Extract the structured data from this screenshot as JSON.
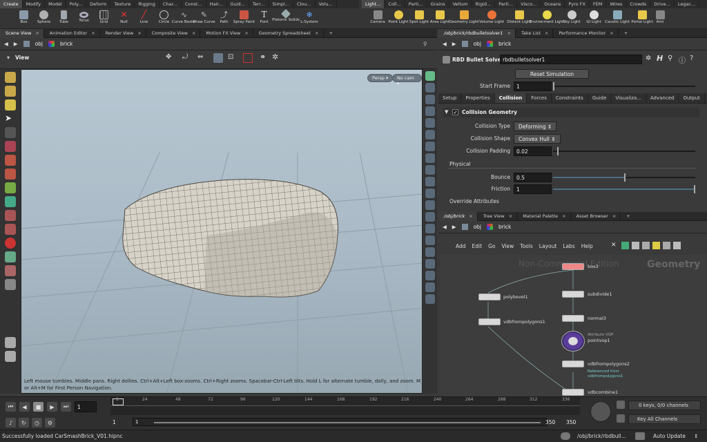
{
  "shelf": {
    "left_tabs": [
      "Create",
      "Modify",
      "Model",
      "Poly...",
      "Deform",
      "Texture",
      "Rigging",
      "Char...",
      "Const...",
      "Hair...",
      "Guid...",
      "Terr...",
      "Simpl...",
      "Clou...",
      "Volu..."
    ],
    "right_tabs": [
      "Light...",
      "Coll...",
      "Parti...",
      "Grains",
      "Vellum",
      "Rigid...",
      "Parti...",
      "Visco...",
      "Oceans",
      "Pyro FX",
      "FEM",
      "Wires",
      "Crowds",
      "Drive...",
      "Legac..."
    ],
    "left_tools": [
      "Box",
      "Sphere",
      "Tube",
      "Torus",
      "Grid",
      "Null",
      "Line",
      "Circle",
      "Curve Bezier",
      "Draw Curve",
      "Path",
      "Spray Paint",
      "Font",
      "Platonic Solids",
      "L-System"
    ],
    "right_tools": [
      "Camera",
      "Point Light",
      "Spot Light",
      "Area Light",
      "Geometry Light",
      "Volume Light",
      "Distant Light",
      "Environment Light",
      "Sky Light",
      "GI Light",
      "Caustic Light",
      "Portal Light",
      "Ami"
    ]
  },
  "left_pane": {
    "tabs": [
      "Scene View",
      "Animation Editor",
      "Render View",
      "Composite View",
      "Motion FX View",
      "Geometry Spreadsheet"
    ],
    "path": [
      "obj",
      "brick"
    ],
    "view_title": "View",
    "persp_label": "Persp ▾",
    "cam_label": "No cam ▾",
    "help_text": "Left mouse tumbles. Middle pans. Right dollies. Ctrl+Alt+Left box-zooms. Ctrl+Right zooms. Spacebar-Ctrl-Left tilts. Hold L for alternate tumble, dolly, and zoom.    M or Alt+M for First Person Navigation."
  },
  "param_pane": {
    "tabs": [
      "/obj/brick/rbdbulletsolver1",
      "Take List",
      "Performance Monitor"
    ],
    "path": [
      "obj",
      "brick"
    ],
    "node_type": "RBD Bullet Solver",
    "node_name": "rbdbulletsolver1",
    "reset_button": "Reset Simulation",
    "start_frame_label": "Start Frame",
    "start_frame_value": "1",
    "subtabs": [
      "Setup",
      "Properties",
      "Collision",
      "Forces",
      "Constraints",
      "Guide",
      "Visualiza...",
      "Advanced",
      "Output"
    ],
    "active_subtab": "Collision",
    "section": "Collision Geometry",
    "collision_type_label": "Collision Type",
    "collision_type_value": "Deforming",
    "collision_shape_label": "Collision Shape",
    "collision_shape_value": "Convex Hull",
    "collision_padding_label": "Collision Padding",
    "collision_padding_value": "0.02",
    "physical_label": "Physical",
    "bounce_label": "Bounce",
    "bounce_value": "0.5",
    "friction_label": "Friction",
    "friction_value": "1",
    "override_label": "Override Attributes"
  },
  "network_pane": {
    "tabs": [
      "/obj/brick",
      "Tree View",
      "Material Palette",
      "Asset Browser"
    ],
    "path": [
      "obj",
      "brick"
    ],
    "menu": [
      "Add",
      "Edit",
      "Go",
      "View",
      "Tools",
      "Layout",
      "Labs",
      "Help"
    ],
    "watermark": "Non-Commercial Edition",
    "context_label": "Geometry",
    "nodes": {
      "box2": "box2",
      "subdivide1": "subdivide1",
      "normal3": "normal3",
      "pointvop1": "pointvop1",
      "pointvop1_type": "Attribute VOP",
      "vdbfrompolygons2": "vdbfrompolygons2",
      "vdbfrompolygons2_note": "Referenced from vdbfrompolygons1",
      "polybevel1": "polybevel1",
      "vdbfrompolygons1": "vdbfrompolygons1",
      "vdbcombine1": "vdbcombine1"
    }
  },
  "timeline": {
    "current_frame": "1",
    "start_frame": "1",
    "range_start": "1",
    "range_end": "350",
    "end_frame": "350",
    "ticks": [
      "1",
      "24",
      "48",
      "72",
      "96",
      "120",
      "144",
      "168",
      "192",
      "216",
      "240",
      "264",
      "288",
      "312",
      "336"
    ],
    "keys_label": "0 keys, 0/0 channels",
    "key_all_label": "Key All Channels"
  },
  "status": {
    "message": "Successfully loaded CarSmashBrick_V01.hipnc",
    "path": "/obj/brick/rbdbull...",
    "update_mode": "Auto Update"
  }
}
